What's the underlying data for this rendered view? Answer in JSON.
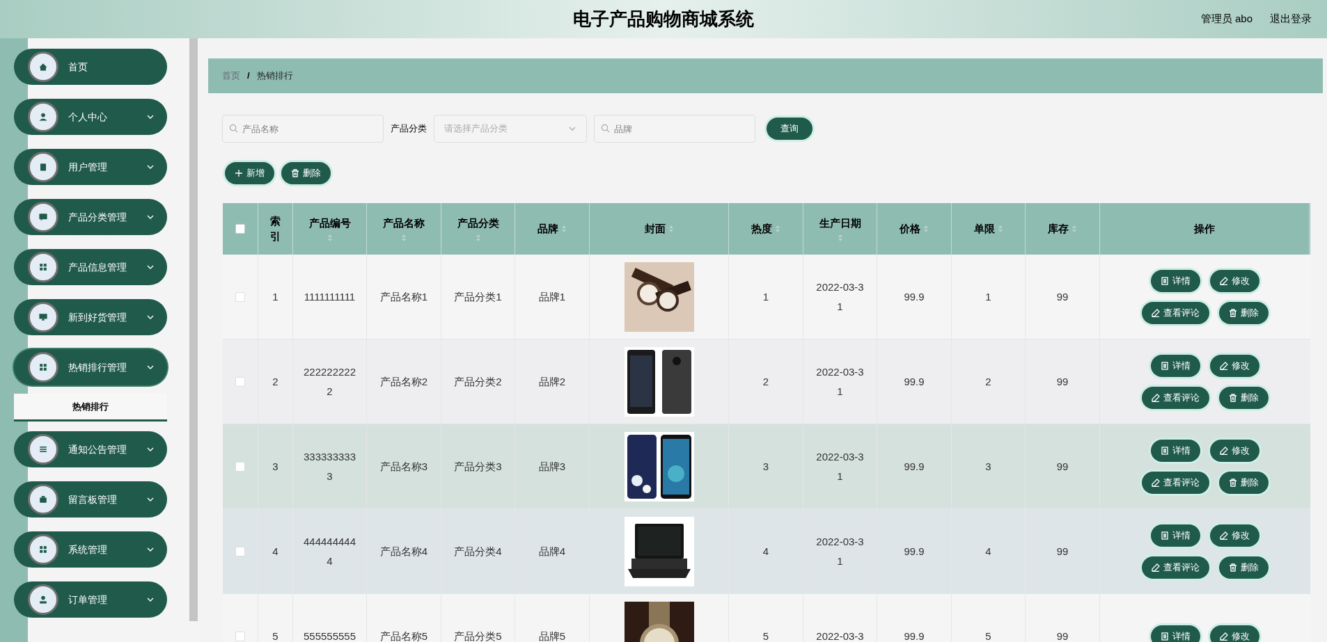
{
  "header": {
    "title": "电子产品购物商城系统",
    "user": "管理员 abo",
    "logout": "退出登录"
  },
  "sidebar": {
    "items": [
      {
        "kind": "link",
        "label": "首页",
        "expanded": false
      },
      {
        "kind": "menu",
        "label": "个人中心",
        "expanded": false
      },
      {
        "kind": "menu",
        "label": "用户管理",
        "expanded": false
      },
      {
        "kind": "menu",
        "label": "产品分类管理",
        "expanded": false
      },
      {
        "kind": "menu",
        "label": "产品信息管理",
        "expanded": false
      },
      {
        "kind": "menu",
        "label": "新到好货管理",
        "expanded": false
      },
      {
        "kind": "menu",
        "label": "热销排行管理",
        "expanded": true,
        "children": [
          {
            "label": "热销排行",
            "selected": true
          }
        ]
      },
      {
        "kind": "menu",
        "label": "通知公告管理",
        "expanded": false
      },
      {
        "kind": "menu",
        "label": "留言板管理",
        "expanded": false
      },
      {
        "kind": "menu",
        "label": "系统管理",
        "expanded": false
      },
      {
        "kind": "menu",
        "label": "订单管理",
        "expanded": false
      }
    ]
  },
  "breadcrumb": {
    "separator": "/",
    "items": [
      "首页",
      "热销排行"
    ]
  },
  "search": {
    "name_placeholder": "产品名称",
    "category_label": "产品分类",
    "category_placeholder": "请选择产品分类",
    "brand_placeholder": "品牌",
    "query_button": "查询"
  },
  "toolbar": [
    "新增",
    "删除"
  ],
  "table": {
    "select_all": {
      "checked": false
    },
    "columns": [
      {
        "kind": "text",
        "label": "索引",
        "sortable": false
      },
      {
        "kind": "text",
        "label": "产品编号",
        "sortable": true
      },
      {
        "kind": "text",
        "label": "产品名称",
        "sortable": true
      },
      {
        "kind": "text",
        "label": "产品分类",
        "sortable": true
      },
      {
        "kind": "text",
        "label": "品牌",
        "sortable": true
      },
      {
        "label": "封面",
        "sortable": true
      },
      {
        "kind": "text",
        "label": "热度",
        "sortable": true
      },
      {
        "kind": "text",
        "label": "生产日期",
        "sortable": true
      },
      {
        "kind": "text",
        "label": "价格",
        "sortable": true
      },
      {
        "kind": "text",
        "label": "单限",
        "sortable": true
      },
      {
        "kind": "text",
        "label": "库存",
        "sortable": true
      },
      {
        "kind": "actions",
        "label": "操作",
        "sortable": false
      }
    ],
    "rows": [
      {
        "checked": false,
        "cells": [
          "1",
          "1111111111",
          "产品名称1",
          "产品分类1",
          "品牌1",
          "",
          "1",
          "2022-03-31",
          "99.9",
          "1",
          "99"
        ],
        "actions": [
          "详情",
          "修改",
          "查看评论",
          "删除"
        ]
      },
      {
        "checked": false,
        "cells": [
          "2",
          "2222222222",
          "产品名称2",
          "产品分类2",
          "品牌2",
          "",
          "2",
          "2022-03-31",
          "99.9",
          "2",
          "99"
        ],
        "actions": [
          "详情",
          "修改",
          "查看评论",
          "删除"
        ]
      },
      {
        "checked": false,
        "cells": [
          "3",
          "3333333333",
          "产品名称3",
          "产品分类3",
          "品牌3",
          "",
          "3",
          "2022-03-31",
          "99.9",
          "3",
          "99"
        ],
        "actions": [
          "详情",
          "修改",
          "查看评论",
          "删除"
        ]
      },
      {
        "checked": false,
        "cells": [
          "4",
          "4444444444",
          "产品名称4",
          "产品分类4",
          "品牌4",
          "",
          "4",
          "2022-03-31",
          "99.9",
          "4",
          "99"
        ],
        "actions": [
          "详情",
          "修改",
          "查看评论",
          "删除"
        ]
      },
      {
        "checked": false,
        "cells": [
          "5",
          "555555555",
          "产品名称5",
          "产品分类5",
          "品牌5",
          "",
          "5",
          "2022-03-3",
          "99.9",
          "5",
          "99"
        ],
        "actions": [
          "详情",
          "修改"
        ]
      }
    ]
  }
}
